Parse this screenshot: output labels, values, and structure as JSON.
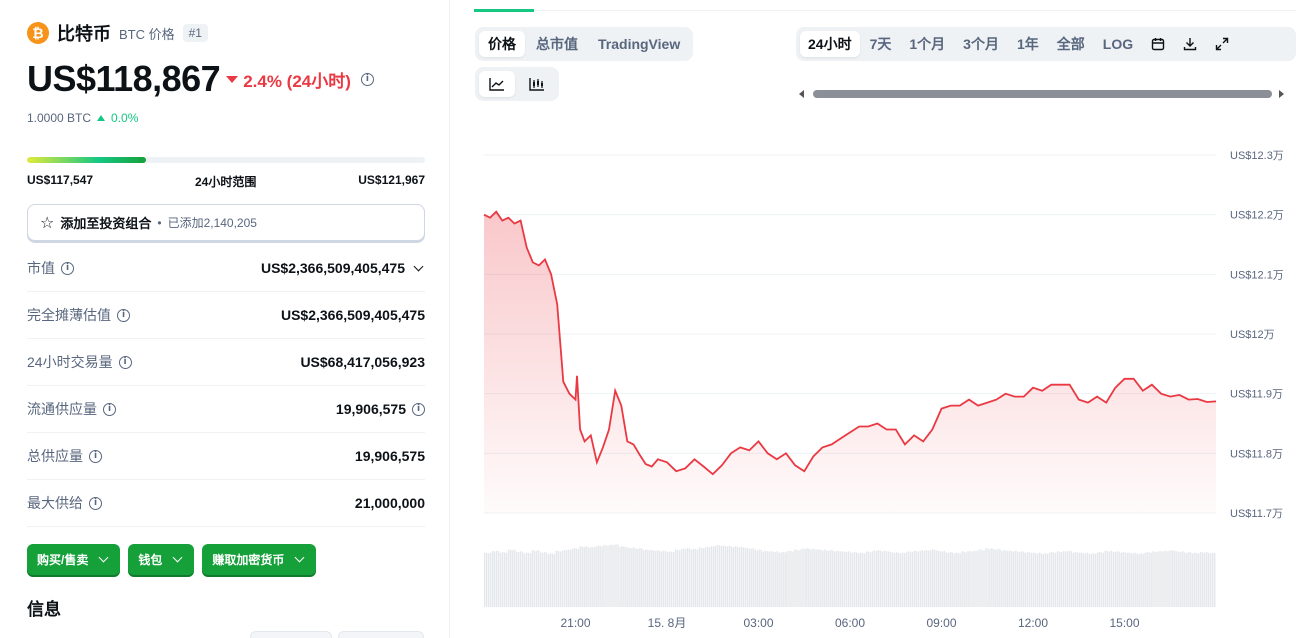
{
  "coin": {
    "logo_glyph": "₿",
    "name": "比特币",
    "symbol_label": "BTC 价格",
    "rank": "#1",
    "price": "US$118,867",
    "change": "2.4% (24小时)",
    "btc_value": "1.0000 BTC",
    "btc_change": "0.0%",
    "colors": {
      "down": "#ea3943",
      "up": "#16c784",
      "brand": "#f7931a"
    }
  },
  "range": {
    "low": "US$117,547",
    "label": "24小时范围",
    "high": "US$121,967",
    "position_fraction": 0.3
  },
  "portfolio": {
    "label": "添加至投资组合",
    "separator": "•",
    "count": "已添加2,140,205",
    "icon": "star-icon"
  },
  "stats": [
    {
      "label": "市值",
      "value": "US$2,366,509,405,475"
    },
    {
      "label": "完全摊薄估值",
      "value": "US$2,366,509,405,475"
    },
    {
      "label": "24小时交易量",
      "value": "US$68,417,056,923"
    },
    {
      "label": "流通供应量",
      "value": "19,906,575"
    },
    {
      "label": "总供应量",
      "value": "19,906,575"
    },
    {
      "label": "最大供给",
      "value": "21,000,000"
    }
  ],
  "actions": [
    "购买/售卖",
    "钱包",
    "赚取加密货币"
  ],
  "section_title": "信息",
  "chart_tabs": [
    "价格",
    "总市值",
    "TradingView"
  ],
  "periods": [
    "24小时",
    "7天",
    "1个月",
    "3个月",
    "1年",
    "全部",
    "LOG"
  ],
  "tools": [
    "calendar-icon",
    "download-icon",
    "expand-icon"
  ],
  "chart_data": {
    "type": "area",
    "title": "",
    "y_ticks": [
      "US$12.3万",
      "US$12.2万",
      "US$12.1万",
      "US$12万",
      "US$11.9万",
      "US$11.8万",
      "US$11.7万"
    ],
    "y_tick_values": [
      123000,
      122000,
      121000,
      120000,
      119000,
      118000,
      117000
    ],
    "ylim": [
      117000,
      123000
    ],
    "x_ticks": [
      "21:00",
      "15. 8月",
      "03:00",
      "06:00",
      "09:00",
      "12:00",
      "15:00"
    ],
    "x_tick_hours": [
      3,
      6,
      9,
      12,
      15,
      18,
      21
    ],
    "xlim_hours": [
      0,
      24
    ],
    "series": [
      {
        "x_hours": [
          0,
          0.2,
          0.4,
          0.6,
          0.8,
          1.0,
          1.2,
          1.4,
          1.6,
          1.8,
          2.0,
          2.2,
          2.4,
          2.6,
          2.8,
          3.0,
          3.05,
          3.15,
          3.3,
          3.5,
          3.7,
          3.9,
          4.1,
          4.3,
          4.5,
          4.7,
          4.9,
          5.1,
          5.3,
          5.5,
          5.7,
          6.0,
          6.3,
          6.6,
          6.9,
          7.2,
          7.5,
          7.8,
          8.1,
          8.4,
          8.7,
          9.0,
          9.3,
          9.6,
          9.9,
          10.2,
          10.5,
          10.8,
          11.1,
          11.4,
          11.7,
          12.0,
          12.3,
          12.6,
          12.9,
          13.2,
          13.5,
          13.8,
          14.1,
          14.4,
          14.7,
          15.0,
          15.3,
          15.6,
          15.9,
          16.2,
          16.5,
          16.8,
          17.1,
          17.4,
          17.7,
          18.0,
          18.3,
          18.6,
          18.9,
          19.2,
          19.5,
          19.8,
          20.1,
          20.4,
          20.7,
          21.0,
          21.3,
          21.6,
          21.9,
          22.2,
          22.5,
          22.8,
          23.1,
          23.4,
          23.7,
          24.0
        ],
        "values": [
          122000,
          121950,
          122050,
          121900,
          121950,
          121850,
          121900,
          121450,
          121200,
          121150,
          121250,
          121000,
          120500,
          119200,
          119000,
          118900,
          119300,
          118400,
          118200,
          118300,
          117850,
          118100,
          118400,
          119050,
          118800,
          118200,
          118150,
          117980,
          117820,
          117780,
          117900,
          117850,
          117700,
          117750,
          117900,
          117780,
          117650,
          117800,
          118000,
          118100,
          118050,
          118200,
          118000,
          117900,
          118000,
          117800,
          117700,
          117950,
          118100,
          118150,
          118250,
          118350,
          118450,
          118450,
          118500,
          118400,
          118400,
          118150,
          118300,
          118200,
          118400,
          118750,
          118800,
          118800,
          118900,
          118800,
          118850,
          118900,
          119000,
          118950,
          118950,
          119100,
          119050,
          119150,
          119150,
          119150,
          118900,
          118850,
          118950,
          118850,
          119100,
          119250,
          119250,
          119050,
          119150,
          119000,
          118950,
          118980,
          118900,
          118910,
          118860,
          118870
        ]
      }
    ],
    "volume_relative": [
      0.85,
      0.88,
      0.86,
      0.9,
      0.87,
      0.85,
      0.89,
      0.86,
      0.84,
      0.88,
      0.9,
      0.92,
      0.95,
      0.94,
      0.96,
      0.97,
      0.98,
      0.95,
      0.93,
      0.92,
      0.9,
      0.89,
      0.88,
      0.87,
      0.9,
      0.92,
      0.91,
      0.93,
      0.95,
      0.97,
      0.96,
      0.95,
      0.94,
      0.92,
      0.9,
      0.88,
      0.87,
      0.86,
      0.88,
      0.9,
      0.92,
      0.91,
      0.9,
      0.89,
      0.88,
      0.87,
      0.86,
      0.85,
      0.87,
      0.89,
      0.88,
      0.86,
      0.85,
      0.87,
      0.88,
      0.89,
      0.9,
      0.88,
      0.86,
      0.85,
      0.87,
      0.88,
      0.9,
      0.92,
      0.91,
      0.89,
      0.88,
      0.87,
      0.86,
      0.85,
      0.84,
      0.86,
      0.87,
      0.88,
      0.86,
      0.85,
      0.84,
      0.86,
      0.88,
      0.87,
      0.86,
      0.85,
      0.84,
      0.86,
      0.87,
      0.88,
      0.89,
      0.87,
      0.86,
      0.85,
      0.86,
      0.85
    ],
    "grid": true,
    "line_color": "#ea3943"
  }
}
